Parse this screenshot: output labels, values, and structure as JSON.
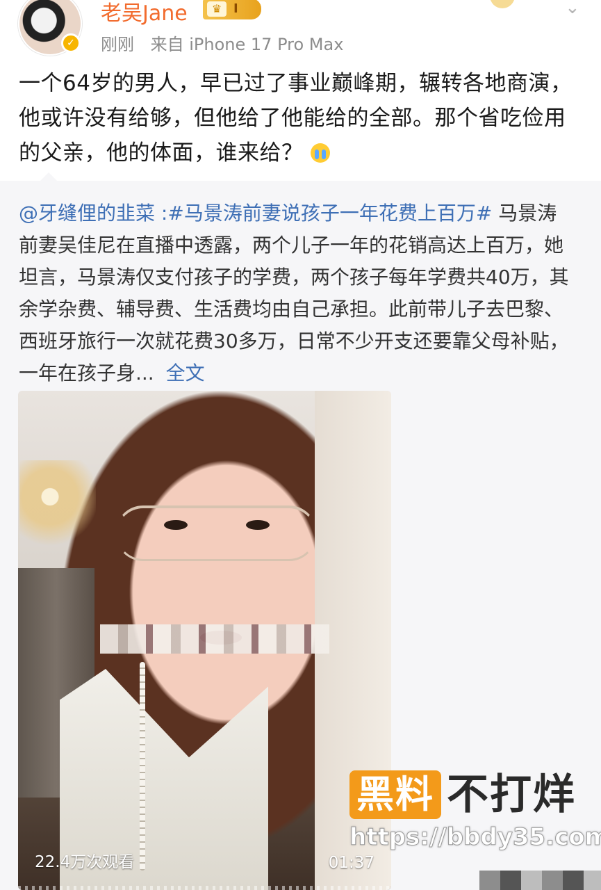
{
  "post": {
    "username": "老吴Jane",
    "vip_level": "I",
    "time": "刚刚",
    "source": "来自 iPhone 17 Pro Max",
    "text": "一个64岁的男人，早已过了事业巅峰期，辗转各地商演，他或许没有给够，但他给了他能给的全部。那个省吃俭用的父亲，他的体面，谁来给？"
  },
  "repost": {
    "author_mention": "@牙缝俚的韭菜",
    "separator": " :",
    "topic": "#马景涛前妻说孩子一年花费上百万#",
    "text": "马景涛前妻吴佳尼在直播中透露，两个儿子一年的花销高达上百万，她坦言，马景涛仅支付孩子的学费，两个孩子每年学费共40万，其余学杂费、辅导费、生活费均由自己承担。此前带儿子去巴黎、西班牙旅行一次就花费30多万，日常不少开支还要靠父母补贴，一年在孩子身...",
    "full_text_link": "全文"
  },
  "video": {
    "views": "22.4万次观看",
    "duration": "01:37"
  },
  "watermark": {
    "box_text": "黑料",
    "title": "不打烊",
    "url": "https://bbdy35.com"
  },
  "colors": {
    "username": "#f26b2d",
    "link": "#3e6fb5",
    "repost_bg": "#f6f6f8",
    "watermark_orange": "#f39a1a"
  }
}
